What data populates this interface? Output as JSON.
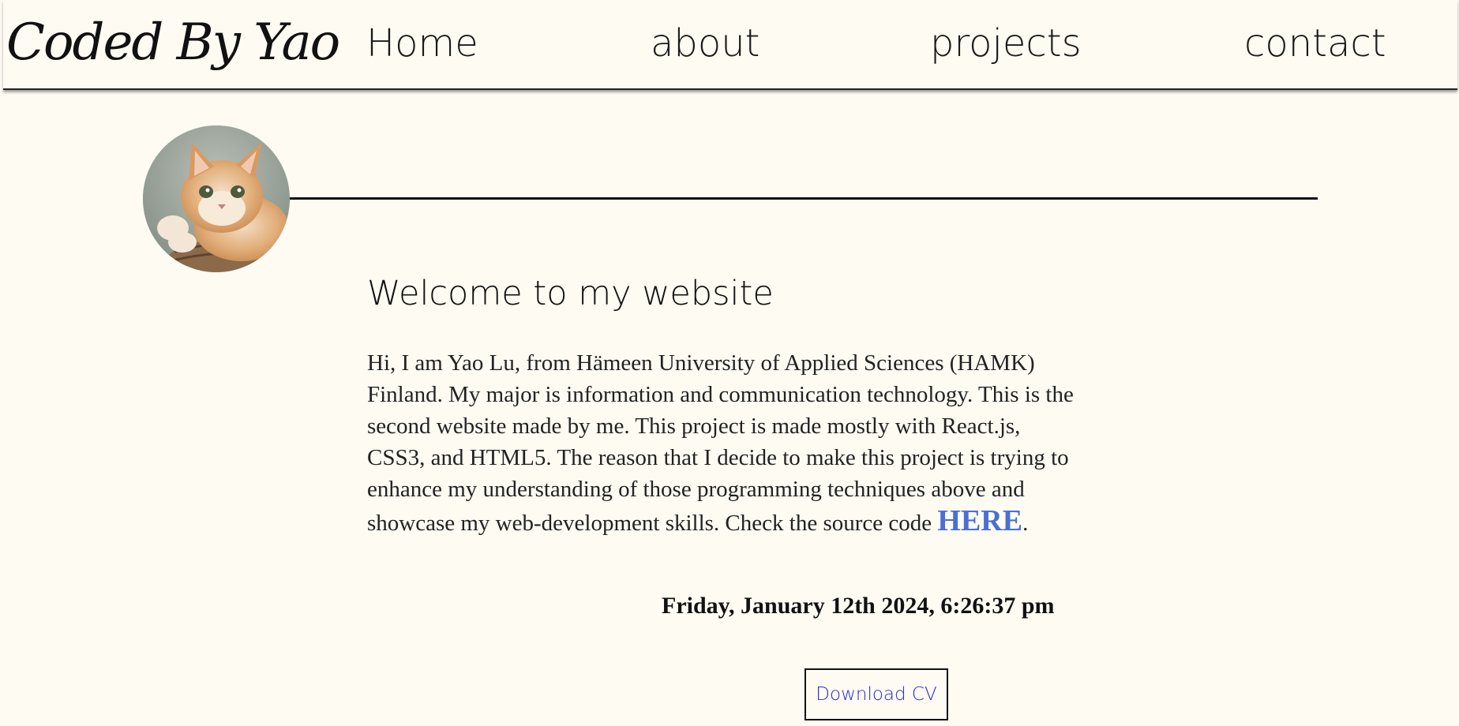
{
  "header": {
    "logo_text": "Coded By Yao",
    "nav": {
      "home": "Home",
      "about": "about",
      "projects": "projects",
      "contact": "contact"
    }
  },
  "profile": {
    "avatar_icon": "cat-photo-avatar"
  },
  "main": {
    "heading": "Welcome to my website",
    "intro_text": "Hi, I am Yao Lu, from Hämeen University of Applied Sciences (HAMK) Finland. My major is information and communication technology. This is the second website made by me. This project is made mostly with React.js, CSS3, and HTML5. The reason that I decide to make this project is trying to enhance my understanding of those programming techniques above and showcase my web-development skills. Check the source code ",
    "source_link_label": "HERE",
    "intro_end": ".",
    "datetime": "Friday, January 12th 2024, 6:26:37 pm",
    "cv_button_label": "Download CV"
  },
  "colors": {
    "background": "#fdfbf2",
    "link": "#4a6fd4",
    "button_text": "#2a2ad8"
  }
}
